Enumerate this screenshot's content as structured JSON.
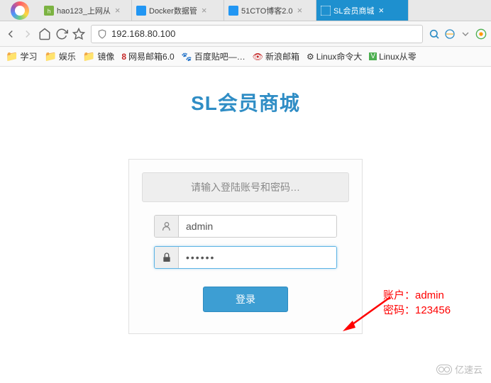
{
  "tabs": [
    {
      "title": "hao123_上网从",
      "favicon_color": "#7cb342"
    },
    {
      "title": "Docker数据管",
      "favicon_color": "#2196f3"
    },
    {
      "title": "51CTO博客2.0",
      "favicon_color": "#2196f3"
    },
    {
      "title": "SL会员商城",
      "favicon_color": "#ffffff",
      "active": true
    }
  ],
  "address": {
    "url": "192.168.80.100"
  },
  "bookmarks": [
    {
      "label": "学习",
      "type": "folder"
    },
    {
      "label": "娱乐",
      "type": "folder"
    },
    {
      "label": "镜像",
      "type": "folder"
    },
    {
      "label": "网易邮箱6.0",
      "type": "link",
      "icon": "8",
      "icon_color": "#c62828"
    },
    {
      "label": "百度贴吧—…",
      "type": "link",
      "icon": "paw",
      "icon_color": "#333"
    },
    {
      "label": "新浪邮箱",
      "type": "link",
      "icon": "eye",
      "icon_color": "#c62828"
    },
    {
      "label": "Linux命令大",
      "type": "link",
      "icon": "gear",
      "icon_color": "#555"
    },
    {
      "label": "Linux从零",
      "type": "link",
      "icon": "V",
      "icon_color": "#4caf50"
    }
  ],
  "page": {
    "title": "SL会员商城",
    "login_prompt": "请输入登陆账号和密码…",
    "username_value": "admin",
    "password_value": "••••••",
    "login_button": "登录"
  },
  "annotation": {
    "line1": "账户：admin",
    "line2": "密码：123456"
  },
  "watermark": "亿速云"
}
